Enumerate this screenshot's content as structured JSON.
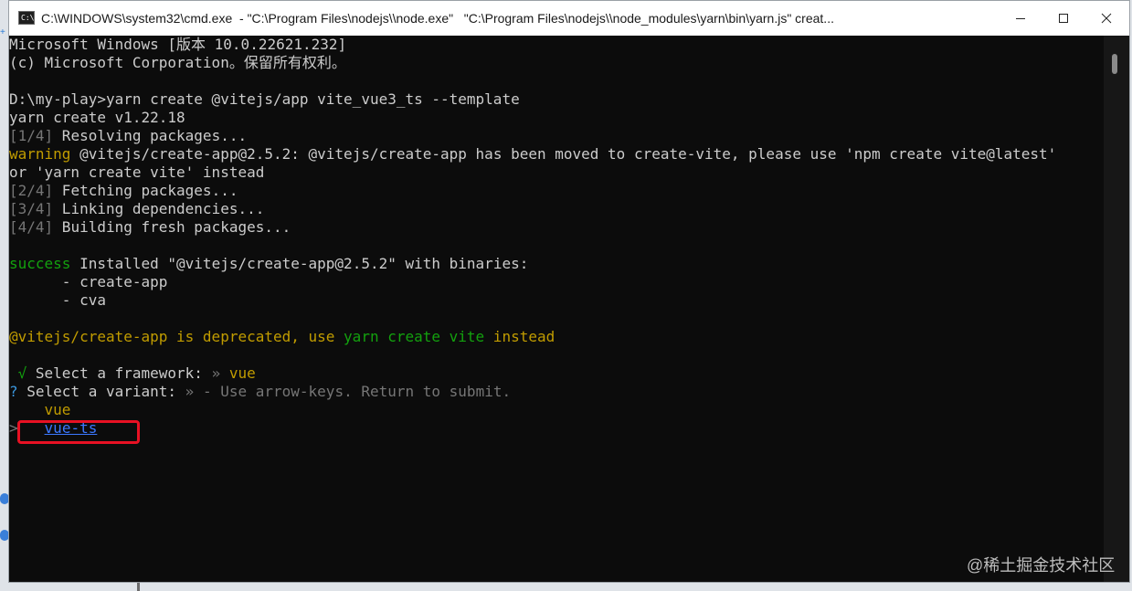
{
  "window": {
    "icon_label": "C:\\",
    "title": "C:\\WINDOWS\\system32\\cmd.exe  - \"C:\\Program Files\\nodejs\\\\node.exe\"   \"C:\\Program Files\\nodejs\\\\node_modules\\yarn\\bin\\yarn.js\" creat...",
    "minimize_label": "—",
    "maximize_label": "☐",
    "close_label": "✕"
  },
  "console": {
    "header1": "Microsoft Windows [版本 10.0.22621.232]",
    "header2": "(c) Microsoft Corporation。保留所有权利。",
    "prompt": "D:\\my-play>yarn create @vitejs/app vite_vue3_ts --template",
    "yarn_version": "yarn create v1.22.18",
    "step1_num": "[1/4]",
    "step1_text": " Resolving packages...",
    "warning_label": "warning",
    "warning_text": " @vitejs/create-app@2.5.2: @vitejs/create-app has been moved to create-vite, please use 'npm create vite@latest'",
    "warning_cont": "or 'yarn create vite' instead",
    "step2_num": "[2/4]",
    "step2_text": " Fetching packages...",
    "step3_num": "[3/4]",
    "step3_text": " Linking dependencies...",
    "step4_num": "[4/4]",
    "step4_text": " Building fresh packages...",
    "success_label": "success",
    "success_text": " Installed \"@vitejs/create-app@2.5.2\" with binaries:",
    "bin1": "      - create-app",
    "bin2": "      - cva",
    "deprecated_a": "@vitejs/create-app is deprecated, use ",
    "deprecated_b": "yarn create vite",
    "deprecated_c": " instead",
    "fw_check": " √",
    "fw_label": " Select a framework: ",
    "fw_arrow": "»",
    "fw_value": " vue",
    "variant_q": "?",
    "variant_label": " Select a variant: ",
    "variant_arrow": "»",
    "variant_hint": " - Use arrow-keys. Return to submit.",
    "option1": "    vue",
    "cursor": ">",
    "option2": "vue-ts"
  },
  "watermark": "@稀土掘金技术社区",
  "colors": {
    "background": "#0c0c0c",
    "text": "#cccccc",
    "gray": "#767676",
    "yellow": "#c19c00",
    "green": "#13a10e",
    "link_blue": "#3b78ff",
    "highlight_red": "#e81123"
  }
}
